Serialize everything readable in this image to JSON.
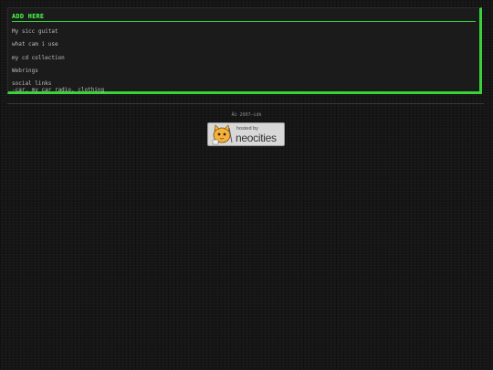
{
  "panel": {
    "title": "ADD HERE",
    "items": [
      {
        "label": "My sicc guitat"
      },
      {
        "label": "what cam i use"
      },
      {
        "label": "my cd collection"
      },
      {
        "label": "Webrings"
      },
      {
        "label": "social links",
        "sub": "-car, my car radio, clothing"
      }
    ]
  },
  "footer": {
    "copyright": "Â© 2007–idk"
  },
  "badge": {
    "small": "hosted by",
    "big": "neocities",
    "icon": "neocities-cat-icon"
  },
  "colors": {
    "accent": "#39d339",
    "background": "#161616"
  }
}
